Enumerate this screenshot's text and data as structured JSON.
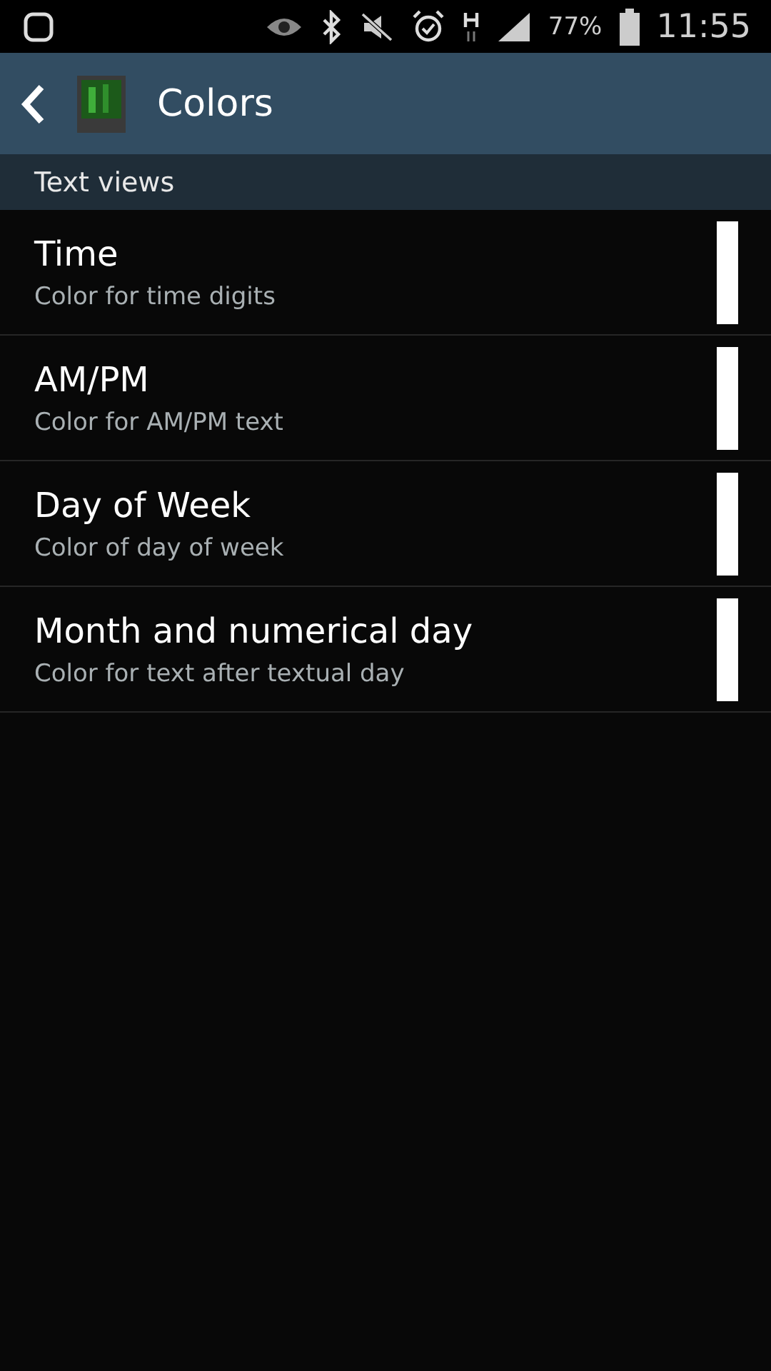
{
  "status_bar": {
    "battery": "77%",
    "time": "11:55"
  },
  "action_bar": {
    "title": "Colors"
  },
  "section": {
    "title": "Text views"
  },
  "items": [
    {
      "title": "Time",
      "summary": "Color for time digits",
      "color": "#ffffff"
    },
    {
      "title": "AM/PM",
      "summary": "Color for AM/PM text",
      "color": "#ffffff"
    },
    {
      "title": "Day of Week",
      "summary": "Color of day of week",
      "color": "#ffffff"
    },
    {
      "title": "Month and numerical day",
      "summary": "Color for text after textual day",
      "color": "#ffffff"
    }
  ]
}
